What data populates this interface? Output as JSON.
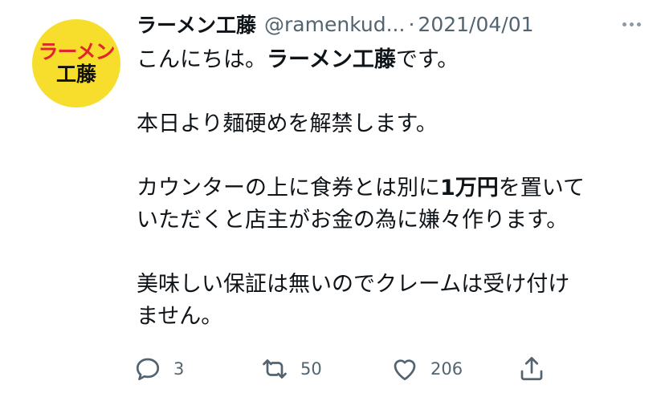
{
  "avatar": {
    "line1": "ラーメン",
    "line2": "工藤",
    "bg": "#f7dd2c",
    "line1_color": "#e0262c"
  },
  "header": {
    "display_name": "ラーメン工藤",
    "handle": "@ramenkud...",
    "separator": "·",
    "date": "2021/04/01",
    "more_icon": "more-horizontal-icon"
  },
  "body": {
    "p1_pre": "こんにちは。",
    "p1_bold": "ラーメン工藤",
    "p1_post": "です。",
    "p2": "本日より麺硬めを解禁します。",
    "p3_pre": "カウンターの上に食券とは別に",
    "p3_bold": "1万円",
    "p3_post1": "を置いて",
    "p3_line2": "いただくと店主がお金の為に嫌々作ります。",
    "p4_line1": "美味しい保証は無いのでクレームは受け付け",
    "p4_line2": "ません。"
  },
  "actions": {
    "reply": {
      "icon": "reply-icon",
      "count": "3"
    },
    "retweet": {
      "icon": "retweet-icon",
      "count": "50"
    },
    "like": {
      "icon": "heart-icon",
      "count": "206"
    },
    "share": {
      "icon": "share-icon"
    }
  },
  "colors": {
    "text": "#0f1419",
    "secondary": "#536471"
  }
}
